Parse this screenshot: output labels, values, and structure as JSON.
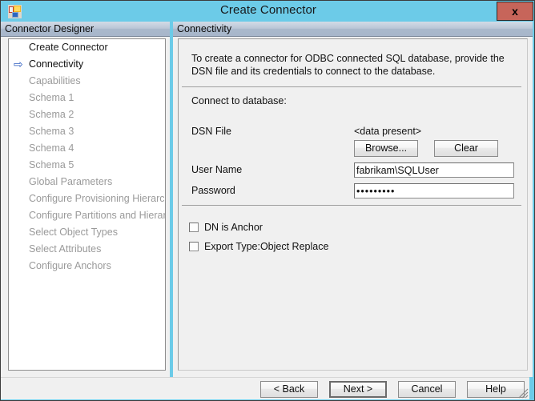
{
  "window": {
    "title": "Create Connector",
    "icon": "connector-app-icon",
    "close_label": "x",
    "accent_color": "#6ccbe8",
    "close_button_color": "#c7655a"
  },
  "left_panel": {
    "header": "Connector Designer",
    "items": [
      {
        "label": "Create Connector",
        "state": "done",
        "arrow": ""
      },
      {
        "label": "Connectivity",
        "state": "current",
        "arrow": "⇨"
      },
      {
        "label": "Capabilities",
        "state": "pending",
        "arrow": ""
      },
      {
        "label": "Schema 1",
        "state": "pending",
        "arrow": ""
      },
      {
        "label": "Schema 2",
        "state": "pending",
        "arrow": ""
      },
      {
        "label": "Schema 3",
        "state": "pending",
        "arrow": ""
      },
      {
        "label": "Schema 4",
        "state": "pending",
        "arrow": ""
      },
      {
        "label": "Schema 5",
        "state": "pending",
        "arrow": ""
      },
      {
        "label": "Global Parameters",
        "state": "pending",
        "arrow": ""
      },
      {
        "label": "Configure Provisioning Hierarchy",
        "state": "pending",
        "arrow": ""
      },
      {
        "label": "Configure Partitions and Hierarchies",
        "state": "pending",
        "arrow": ""
      },
      {
        "label": "Select Object Types",
        "state": "pending",
        "arrow": ""
      },
      {
        "label": "Select Attributes",
        "state": "pending",
        "arrow": ""
      },
      {
        "label": "Configure Anchors",
        "state": "pending",
        "arrow": ""
      }
    ]
  },
  "right_panel": {
    "header": "Connectivity",
    "intro": "To create a connector for ODBC connected SQL database, provide the DSN file and its credentials to connect to the database.",
    "section_label": "Connect to database:",
    "fields": {
      "dsn_label": "DSN File",
      "dsn_value": "<data present>",
      "browse_label": "Browse...",
      "clear_label": "Clear",
      "user_label": "User Name",
      "user_value": "fabrikam\\SQLUser",
      "password_label": "Password",
      "password_value": "•••••••••"
    },
    "checkboxes": [
      {
        "label": "DN is Anchor",
        "checked": false
      },
      {
        "label": "Export Type:Object Replace",
        "checked": false
      }
    ]
  },
  "footer": {
    "back_label": "< Back",
    "next_label": "Next  >",
    "cancel_label": "Cancel",
    "help_label": "Help"
  }
}
